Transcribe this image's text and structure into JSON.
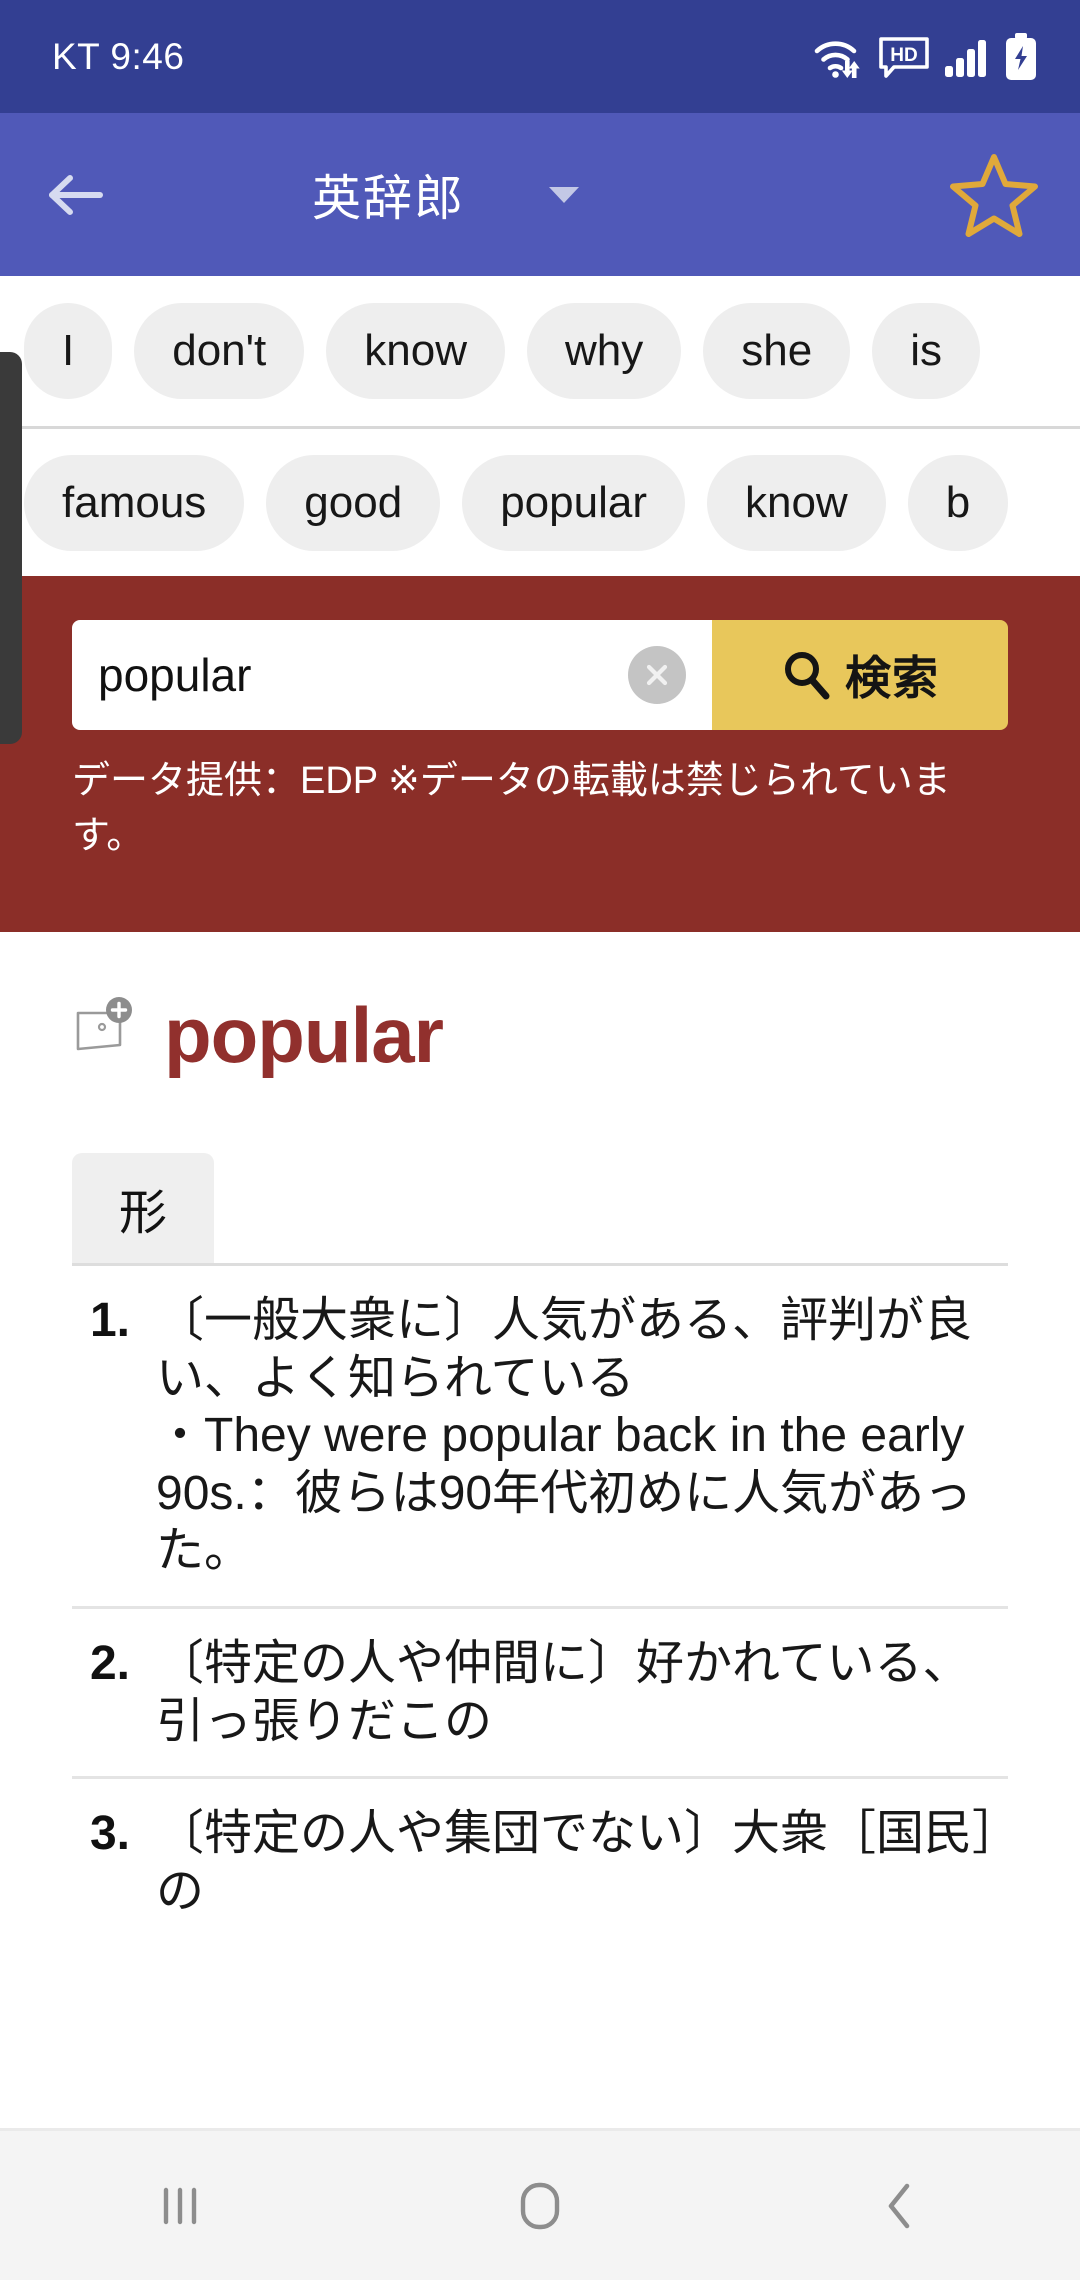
{
  "statusbar": {
    "carrier_time": "KT 9:46",
    "icons": [
      "wifi-icon",
      "hd-icon",
      "signal-icon",
      "battery-charging-icon"
    ]
  },
  "appbar": {
    "back_icon": "back-arrow-icon",
    "title": "英辞郎",
    "dropdown_icon": "chevron-down-icon",
    "favorite_icon": "star-outline-icon",
    "background_color": "#5059b8"
  },
  "suggestions": {
    "row1": [
      "I",
      "don't",
      "know",
      "why",
      "she",
      "is"
    ],
    "row2": [
      "famous",
      "good",
      "popular",
      "know",
      "b"
    ]
  },
  "search": {
    "value": "popular",
    "placeholder": "",
    "clear_icon": "close-circle-icon",
    "search_icon": "magnifier-icon",
    "button_label": "検索",
    "button_color": "#e8c75b",
    "banner_color": "#8b2e28",
    "note": "データ提供：EDP ※データの転載は禁じられています。"
  },
  "entry": {
    "add_card_icon": "add-word-card-icon",
    "headword": "popular",
    "headword_color": "#91302d",
    "pos_tabs": [
      {
        "label": "形",
        "selected": true
      }
    ],
    "definitions": [
      {
        "number": "1.",
        "text": "〔一般大衆に〕人気がある、評判が良い、よく知られている",
        "example": "・They were popular back in the early 90s.：彼らは90年代初めに人気があった。"
      },
      {
        "number": "2.",
        "text": "〔特定の人や仲間に〕好かれている、引っ張りだこの",
        "example": ""
      },
      {
        "number": "3.",
        "text": "〔特定の人や集団でない〕大衆［国民］の",
        "example": ""
      }
    ]
  },
  "navbar": {
    "recents_icon": "recents-icon",
    "home_icon": "home-icon",
    "back_icon": "back-chevron-icon"
  }
}
